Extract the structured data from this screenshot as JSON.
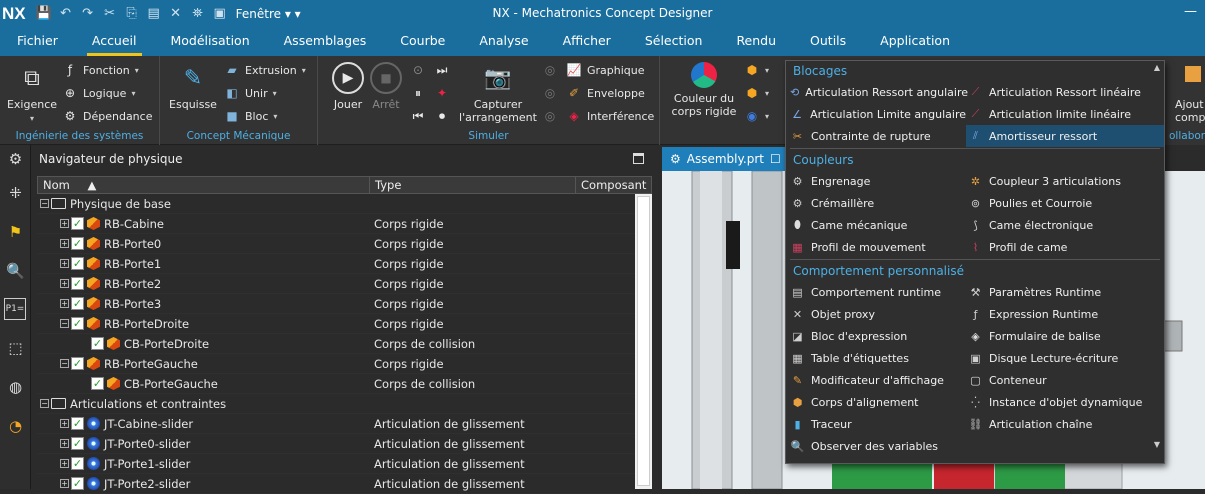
{
  "app": {
    "logo": "NX",
    "window_menu": "Fenêtre",
    "title": "NX - Mechatronics Concept Designer"
  },
  "menubar": [
    {
      "label": "Fichier"
    },
    {
      "label": "Accueil",
      "active": true
    },
    {
      "label": "Modélisation"
    },
    {
      "label": "Assemblages"
    },
    {
      "label": "Courbe"
    },
    {
      "label": "Analyse"
    },
    {
      "label": "Afficher"
    },
    {
      "label": "Sélection"
    },
    {
      "label": "Rendu"
    },
    {
      "label": "Outils"
    },
    {
      "label": "Application"
    }
  ],
  "ribbon": {
    "groups": {
      "systemes": "Ingénierie des systèmes",
      "mecanique": "Concept Mécanique",
      "simuler": "Simuler"
    },
    "exigence": "Exigence",
    "fonction": "Fonction",
    "logique": "Logique",
    "dependance": "Dépendance",
    "esquisse": "Esquisse",
    "extrusion": "Extrusion",
    "unir": "Unir",
    "bloc": "Bloc",
    "jouer": "Jouer",
    "arret": "Arrêt",
    "capturer_1": "Capturer",
    "capturer_2": "l'arrangement",
    "graphique": "Graphique",
    "enveloppe": "Enveloppe",
    "interference": "Interférence",
    "couleur_1": "Couleur du",
    "couleur_2": "corps rigide",
    "ajout_1": "Ajout",
    "ajout_2": "compo",
    "collabo": "ollabora"
  },
  "navigator": {
    "title": "Navigateur de physique",
    "columns": [
      "Nom",
      "Type",
      "Composant"
    ],
    "rows": [
      {
        "indent": 0,
        "kind": "folder",
        "name": "Physique de base",
        "type": ""
      },
      {
        "indent": 1,
        "kind": "cube",
        "name": "RB-Cabine",
        "type": "Corps rigide"
      },
      {
        "indent": 1,
        "kind": "cube",
        "name": "RB-Porte0",
        "type": "Corps rigide"
      },
      {
        "indent": 1,
        "kind": "cube",
        "name": "RB-Porte1",
        "type": "Corps rigide"
      },
      {
        "indent": 1,
        "kind": "cube",
        "name": "RB-Porte2",
        "type": "Corps rigide"
      },
      {
        "indent": 1,
        "kind": "cube",
        "name": "RB-Porte3",
        "type": "Corps rigide"
      },
      {
        "indent": 1,
        "kind": "cube",
        "name": "RB-PorteDroite",
        "type": "Corps rigide",
        "open": true
      },
      {
        "indent": 2,
        "kind": "cube",
        "name": "CB-PorteDroite",
        "type": "Corps de collision"
      },
      {
        "indent": 1,
        "kind": "cube",
        "name": "RB-PorteGauche",
        "type": "Corps rigide",
        "open": true
      },
      {
        "indent": 2,
        "kind": "cube",
        "name": "CB-PorteGauche",
        "type": "Corps de collision"
      },
      {
        "indent": 0,
        "kind": "folder",
        "name": "Articulations et contraintes",
        "type": ""
      },
      {
        "indent": 1,
        "kind": "joint",
        "name": "JT-Cabine-slider",
        "type": "Articulation de glissement"
      },
      {
        "indent": 1,
        "kind": "joint",
        "name": "JT-Porte0-slider",
        "type": "Articulation de glissement"
      },
      {
        "indent": 1,
        "kind": "joint",
        "name": "JT-Porte1-slider",
        "type": "Articulation de glissement"
      },
      {
        "indent": 1,
        "kind": "joint",
        "name": "JT-Porte2-slider",
        "type": "Articulation de glissement"
      }
    ]
  },
  "tab": {
    "label": "Assembly.prt"
  },
  "dropdown": {
    "sections": [
      {
        "title": "Blocages",
        "items": [
          {
            "label": "Articulation Ressort angulaire",
            "icon": "spring-joint-icon"
          },
          {
            "label": "Articulation Ressort linéaire",
            "icon": "linear-spring-icon"
          },
          {
            "label": "Articulation Limite angulaire",
            "icon": "angular-limit-icon"
          },
          {
            "label": "Articulation limite linéaire",
            "icon": "linear-limit-icon"
          },
          {
            "label": "Contrainte de rupture",
            "icon": "breaking-constraint-icon"
          },
          {
            "label": "Amortisseur ressort",
            "icon": "spring-damper-icon",
            "selected": true
          }
        ]
      },
      {
        "title": "Coupleurs",
        "items": [
          {
            "label": "Engrenage",
            "icon": "gear-icon"
          },
          {
            "label": "Coupleur 3 articulations",
            "icon": "coupler-icon"
          },
          {
            "label": "Crémaillère",
            "icon": "rack-icon"
          },
          {
            "label": "Poulies et Courroie",
            "icon": "pulley-icon"
          },
          {
            "label": "Came mécanique",
            "icon": "cam-icon"
          },
          {
            "label": "Came électronique",
            "icon": "electronic-cam-icon"
          },
          {
            "label": "Profil de mouvement",
            "icon": "motion-profile-icon"
          },
          {
            "label": "Profil de came",
            "icon": "cam-profile-icon"
          }
        ]
      },
      {
        "title": "Comportement personnalisé",
        "items": [
          {
            "label": "Comportement runtime",
            "icon": "runtime-icon"
          },
          {
            "label": "Paramètres Runtime",
            "icon": "parameters-icon"
          },
          {
            "label": "Objet proxy",
            "icon": "proxy-icon"
          },
          {
            "label": "Expression Runtime",
            "icon": "expression-icon"
          },
          {
            "label": "Bloc d'expression",
            "icon": "expression-block-icon"
          },
          {
            "label": "Formulaire de balise",
            "icon": "tag-form-icon"
          },
          {
            "label": "Table d'étiquettes",
            "icon": "label-table-icon"
          },
          {
            "label": "Disque Lecture-écriture",
            "icon": "read-write-icon"
          },
          {
            "label": "Modificateur d'affichage",
            "icon": "display-modifier-icon"
          },
          {
            "label": "Conteneur",
            "icon": "container-icon"
          },
          {
            "label": "Corps d'alignement",
            "icon": "alignment-icon"
          },
          {
            "label": "Instance d'objet dynamique",
            "icon": "dynamic-object-icon"
          },
          {
            "label": "Traceur",
            "icon": "tracer-icon"
          },
          {
            "label": "Articulation chaîne",
            "icon": "chain-icon"
          },
          {
            "label": "Observer des variables",
            "icon": "watch-icon"
          }
        ]
      }
    ]
  }
}
